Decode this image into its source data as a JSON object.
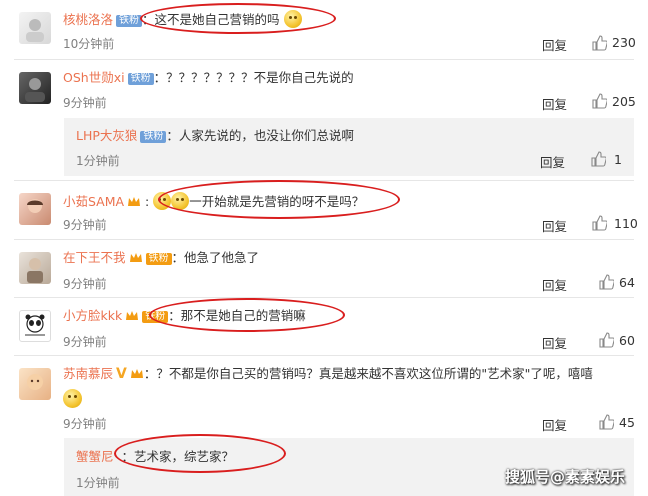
{
  "comments": [
    {
      "user": "核桃洛洛",
      "badge": "铁粉",
      "text": "：这不是她自己营销的吗",
      "time": "10分钟前",
      "reply": "回复",
      "likes": "230"
    },
    {
      "user": "OSh世勋xi",
      "badge": "铁粉",
      "text": "：？？？？？？？不是你自己先说的",
      "time": "9分钟前",
      "reply": "回复",
      "likes": "205"
    },
    {
      "user": "小茹SAMA",
      "badge": "",
      "text": "一开始就是先营销的呀不是吗？",
      "time": "9分钟前",
      "reply": "回复",
      "likes": "110"
    },
    {
      "user": "在下王不我",
      "badge": "铁粉",
      "text": "：他急了他急了",
      "time": "9分钟前",
      "reply": "回复",
      "likes": "64"
    },
    {
      "user": "小方脸kkk",
      "badge": "铁粉",
      "text": "：那不是她自己的营销嘛",
      "time": "9分钟前",
      "reply": "回复",
      "likes": "60"
    },
    {
      "user": "苏南慕辰",
      "badge": "V",
      "text": "：？不都是你自己买的营销吗？真是越来越不喜欢这位所谓的\"艺术家\"了呢，嘻嘻",
      "time": "9分钟前",
      "reply": "回复",
      "likes": "45"
    }
  ],
  "subreplies": [
    {
      "user": "LHP大灰狼",
      "badge": "铁粉",
      "text": "：人家先说的，也没让你们总说啊",
      "time": "1分钟前",
      "reply": "回复",
      "likes": "1"
    },
    {
      "user": "蟹蟹尼",
      "text": "：艺术家，综艺家？",
      "time": "1分钟前"
    }
  ],
  "watermark": "搜狐号@素素娱乐",
  "colors": {
    "username": "#eb7350",
    "fan_badge": "#6fa0d9",
    "highlight": "#d91e1e"
  }
}
